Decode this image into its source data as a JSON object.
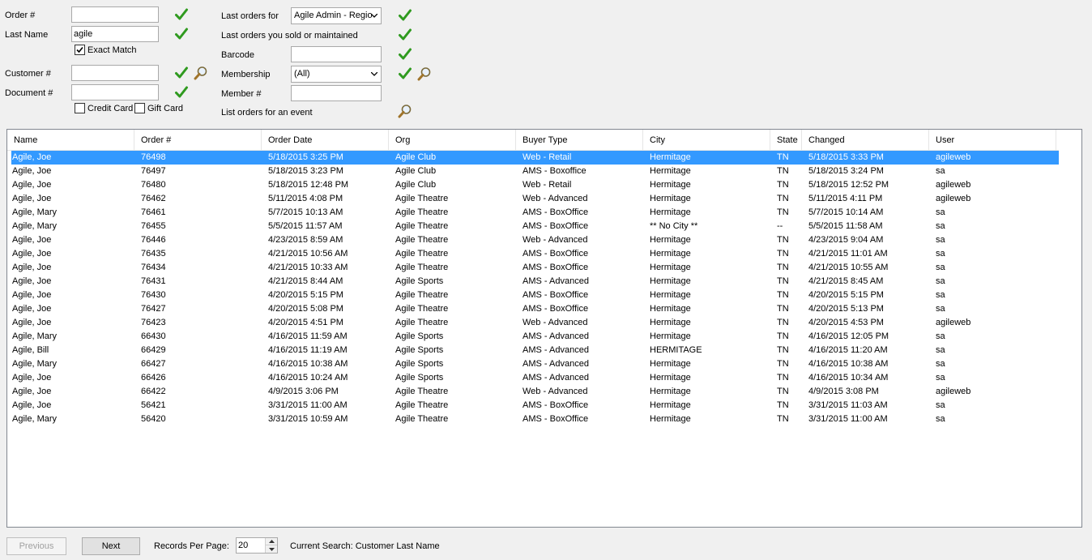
{
  "search": {
    "order_label": "Order #",
    "order_value": "",
    "last_name_label": "Last Name",
    "last_name_value": "agile",
    "exact_match_label": "Exact Match",
    "exact_match_checked": true,
    "customer_label": "Customer #",
    "customer_value": "",
    "document_label": "Document #",
    "document_value": "",
    "credit_card_label": "Credit Card",
    "credit_card_checked": false,
    "gift_card_label": "Gift Card",
    "gift_card_checked": false,
    "last_orders_for_label": "Last orders for",
    "last_orders_for_value": "Agile Admin - Regio",
    "last_orders_sold_label": "Last orders you sold or maintained",
    "barcode_label": "Barcode",
    "barcode_value": "",
    "membership_label": "Membership",
    "membership_value": "(All)",
    "member_label": "Member #",
    "member_value": "",
    "list_orders_event_label": "List orders for an event"
  },
  "icons": {
    "go": "check-icon",
    "lookup": "magnifier-icon"
  },
  "colors": {
    "check": "#2f9a1f",
    "selection": "#3399ff"
  },
  "grid": {
    "columns": [
      "Name",
      "Order #",
      "Order Date",
      "Org",
      "Buyer Type",
      "City",
      "State",
      "Changed",
      "User"
    ],
    "selected_row": 0,
    "rows": [
      [
        "Agile, Joe",
        "76498",
        "5/18/2015 3:25 PM",
        "Agile Club",
        "Web - Retail",
        "Hermitage",
        "TN",
        "5/18/2015 3:33 PM",
        "agileweb"
      ],
      [
        "Agile, Joe",
        "76497",
        "5/18/2015 3:23 PM",
        "Agile Club",
        "AMS - Boxoffice",
        "Hermitage",
        "TN",
        "5/18/2015 3:24 PM",
        "sa"
      ],
      [
        "Agile, Joe",
        "76480",
        "5/18/2015 12:48 PM",
        "Agile Club",
        "Web - Retail",
        "Hermitage",
        "TN",
        "5/18/2015 12:52 PM",
        "agileweb"
      ],
      [
        "Agile, Joe",
        "76462",
        "5/11/2015 4:08 PM",
        "Agile Theatre",
        "Web - Advanced",
        "Hermitage",
        "TN",
        "5/11/2015 4:11 PM",
        "agileweb"
      ],
      [
        "Agile, Mary",
        "76461",
        "5/7/2015 10:13 AM",
        "Agile Theatre",
        "AMS - BoxOffice",
        "Hermitage",
        "TN",
        "5/7/2015 10:14 AM",
        "sa"
      ],
      [
        "Agile, Mary",
        "76455",
        "5/5/2015 11:57 AM",
        "Agile Theatre",
        "AMS - BoxOffice",
        "** No City **",
        "--",
        "5/5/2015 11:58 AM",
        "sa"
      ],
      [
        "Agile, Joe",
        "76446",
        "4/23/2015 8:59 AM",
        "Agile Theatre",
        "Web - Advanced",
        "Hermitage",
        "TN",
        "4/23/2015 9:04 AM",
        "sa"
      ],
      [
        "Agile, Joe",
        "76435",
        "4/21/2015 10:56 AM",
        "Agile Theatre",
        "AMS - BoxOffice",
        "Hermitage",
        "TN",
        "4/21/2015 11:01 AM",
        "sa"
      ],
      [
        "Agile, Joe",
        "76434",
        "4/21/2015 10:33 AM",
        "Agile Theatre",
        "AMS - BoxOffice",
        "Hermitage",
        "TN",
        "4/21/2015 10:55 AM",
        "sa"
      ],
      [
        "Agile, Joe",
        "76431",
        "4/21/2015 8:44 AM",
        "Agile Sports",
        "AMS - Advanced",
        "Hermitage",
        "TN",
        "4/21/2015 8:45 AM",
        "sa"
      ],
      [
        "Agile, Joe",
        "76430",
        "4/20/2015 5:15 PM",
        "Agile Theatre",
        "AMS - BoxOffice",
        "Hermitage",
        "TN",
        "4/20/2015 5:15 PM",
        "sa"
      ],
      [
        "Agile, Joe",
        "76427",
        "4/20/2015 5:08 PM",
        "Agile Theatre",
        "AMS - BoxOffice",
        "Hermitage",
        "TN",
        "4/20/2015 5:13 PM",
        "sa"
      ],
      [
        "Agile, Joe",
        "76423",
        "4/20/2015 4:51 PM",
        "Agile Theatre",
        "Web - Advanced",
        "Hermitage",
        "TN",
        "4/20/2015 4:53 PM",
        "agileweb"
      ],
      [
        "Agile, Mary",
        "66430",
        "4/16/2015 11:59 AM",
        "Agile Sports",
        "AMS - Advanced",
        "Hermitage",
        "TN",
        "4/16/2015 12:05 PM",
        "sa"
      ],
      [
        "Agile, Bill",
        "66429",
        "4/16/2015 11:19 AM",
        "Agile Sports",
        "AMS - Advanced",
        "HERMITAGE",
        "TN",
        "4/16/2015 11:20 AM",
        "sa"
      ],
      [
        "Agile, Mary",
        "66427",
        "4/16/2015 10:38 AM",
        "Agile Sports",
        "AMS - Advanced",
        "Hermitage",
        "TN",
        "4/16/2015 10:38 AM",
        "sa"
      ],
      [
        "Agile, Joe",
        "66426",
        "4/16/2015 10:24 AM",
        "Agile Sports",
        "AMS - Advanced",
        "Hermitage",
        "TN",
        "4/16/2015 10:34 AM",
        "sa"
      ],
      [
        "Agile, Joe",
        "66422",
        "4/9/2015 3:06 PM",
        "Agile Theatre",
        "Web - Advanced",
        "Hermitage",
        "TN",
        "4/9/2015 3:08 PM",
        "agileweb"
      ],
      [
        "Agile, Joe",
        "56421",
        "3/31/2015 11:00 AM",
        "Agile Theatre",
        "AMS - BoxOffice",
        "Hermitage",
        "TN",
        "3/31/2015 11:03 AM",
        "sa"
      ],
      [
        "Agile, Mary",
        "56420",
        "3/31/2015 10:59 AM",
        "Agile Theatre",
        "AMS - BoxOffice",
        "Hermitage",
        "TN",
        "3/31/2015 11:00 AM",
        "sa"
      ]
    ]
  },
  "footer": {
    "previous_label": "Previous",
    "next_label": "Next",
    "records_per_page_label": "Records Per Page:",
    "records_per_page_value": "20",
    "current_search_text": "Current Search: Customer Last Name"
  }
}
